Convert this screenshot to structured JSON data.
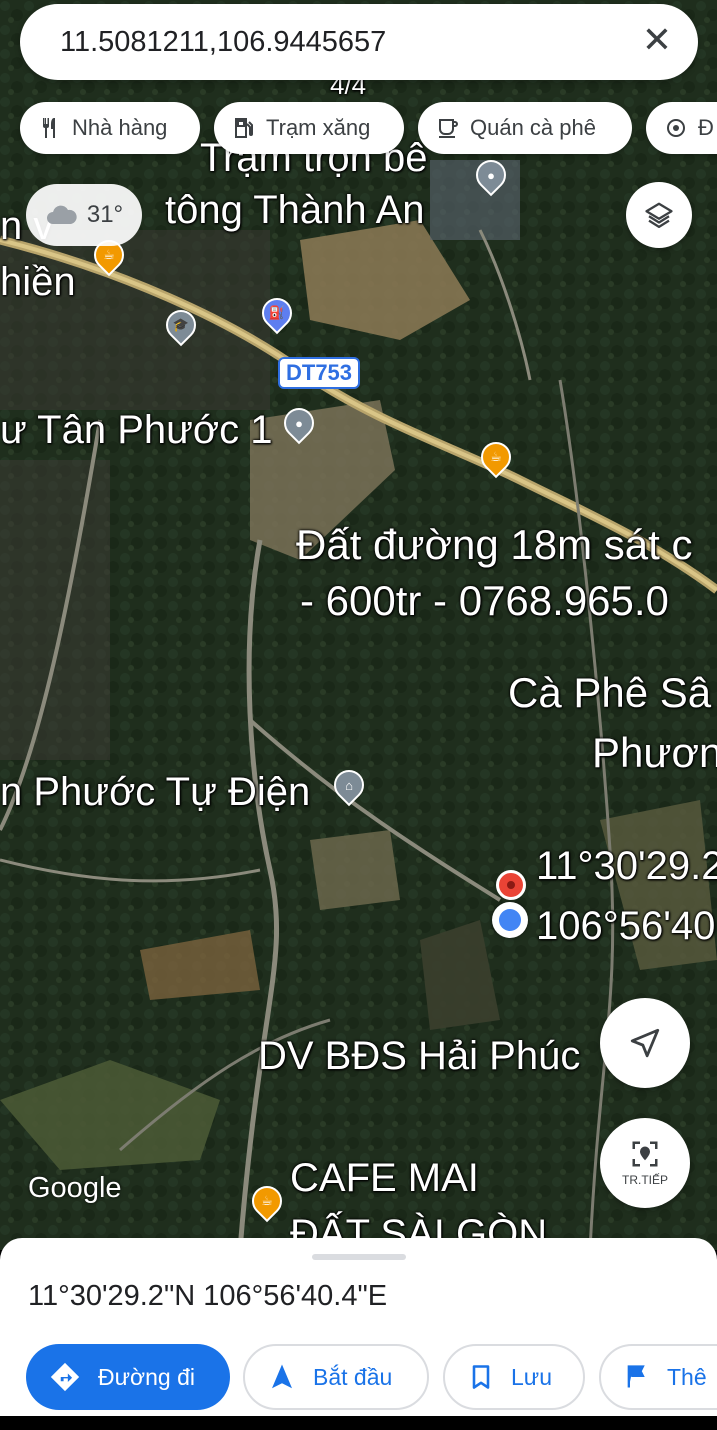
{
  "search": {
    "query": "11.5081211,106.9445657",
    "close_icon": "close-icon"
  },
  "chips": [
    {
      "label": "Nhà hàng",
      "icon": "restaurant-icon"
    },
    {
      "label": "Trạm xăng",
      "icon": "gas-station-icon"
    },
    {
      "label": "Quán cà phê",
      "icon": "coffee-icon"
    },
    {
      "label": "Đ",
      "icon": "attraction-icon"
    }
  ],
  "weather": {
    "temp": "31°",
    "icon": "cloudy-icon"
  },
  "map": {
    "labels": {
      "tram_tron": "Trạm trộn bê",
      "be_tong": "tông Thành An",
      "partial_4_4": "4/4",
      "hien": "hiền",
      "partial_v": "n v",
      "tan_phuoc": "ư Tân Phước 1",
      "dat_duong": "Đất đường 18m sát c",
      "price": "- 600tr - 0768.965.0",
      "ca_phe": "Cà Phê Sâ",
      "phuon": "Phươn",
      "tu_dien": "n Phước Tự Điện",
      "coord_lat": "11°30'29.2",
      "coord_lng": "106°56'40",
      "dv_bds": "DV BĐS Hải Phúc",
      "partial_n": "n",
      "cafe_mai": "CAFE MAI",
      "dat_saigon": "ĐẤT SÀI GÒN"
    },
    "road_shield": "DT753",
    "google": "Google",
    "live_view_label": "TR.TIẾP"
  },
  "sheet": {
    "coordinates": "11°30'29.2\"N 106°56'40.4\"E",
    "actions": {
      "directions": "Đường đi",
      "start": "Bắt đầu",
      "save": "Lưu",
      "more": "Thê"
    }
  },
  "colors": {
    "accent": "#1a73e8",
    "pin_red": "#ea4335",
    "poi_orange": "#f29900"
  }
}
